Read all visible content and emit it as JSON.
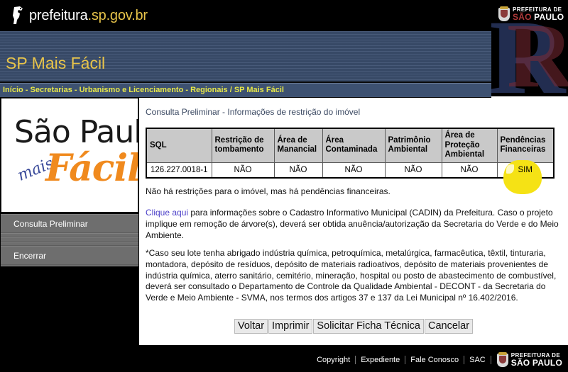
{
  "topbar": {
    "brand_prefix": "prefeitura",
    "brand_suffix": ".sp.gov.br",
    "logo_icon": "sao-paulo-mark-icon"
  },
  "prefeitura_logo": {
    "line1": "PREFEITURA DE",
    "line2_prefix": "SÃO",
    "line2_suffix": " PAULO",
    "watermark": "R",
    "crest_icon": "city-crest-icon"
  },
  "banner": {
    "title": "SP Mais Fácil"
  },
  "breadcrumb": {
    "text": "Início - Secretarias - Urbanismo e Licenciamento - Regionais / SP Mais Fácil"
  },
  "sidebar": {
    "logo": {
      "line1": "São Paulo",
      "script": "mais",
      "line2": "Fácil"
    },
    "items": [
      {
        "label": "Consulta Preliminar"
      },
      {
        "label": "Encerrar"
      }
    ]
  },
  "main": {
    "title": "Consulta Preliminar - Informações de restrição do imóvel",
    "table": {
      "headers": [
        "SQL",
        "Restrição de tombamento",
        "Área de Manancial",
        "Área Contaminada",
        "Patrimônio Ambiental",
        "Área de Proteção Ambiental",
        "Pendências Financeiras"
      ],
      "rows": [
        {
          "sql": "126.227.0018-1",
          "restricao_tombamento": "NÃO",
          "area_manancial": "NÃO",
          "area_contaminada": "NÃO",
          "patrimonio_ambiental": "NÃO",
          "area_protecao_ambiental": "NÃO",
          "pendencias_financeiras": "SIM"
        }
      ],
      "highlight_color": "#f5e215"
    },
    "paragraph_1": "Não há restrições para o imóvel, mas há pendências financeiras.",
    "paragraph_2": {
      "link_text": "Clique aqui",
      "rest": " para informações sobre o Cadastro Informativo Municipal (CADIN) da Prefeitura. Caso o projeto implique em remoção de árvore(s), deverá ser obtida anuência/autorização da Secretaria do Verde e do Meio Ambiente."
    },
    "paragraph_3": "*Caso seu lote tenha abrigado indústria química, petroquímica, metalúrgica, farmacêutica, têxtil, tinturaria, montadora, depósito de resíduos, depósito de materiais radioativos, depósito de materiais provenientes de indústria química, aterro sanitário, cemitério, mineração, hospital ou posto de abastecimento de combustível, deverá ser consultado o Departamento de Controle da Qualidade Ambiental - DECONT - da Secretaria do Verde e Meio Ambiente - SVMA, nos termos dos artigos 37 e 137 da Lei Municipal nº 16.402/2016.",
    "buttons": [
      {
        "label": "Voltar"
      },
      {
        "label": "Imprimir"
      },
      {
        "label": "Solicitar Ficha Técnica"
      },
      {
        "label": "Cancelar"
      }
    ]
  },
  "footer": {
    "links": [
      {
        "label": "Copyright"
      },
      {
        "label": "Expediente"
      },
      {
        "label": "Fale Conosco"
      },
      {
        "label": "SAC"
      }
    ]
  }
}
